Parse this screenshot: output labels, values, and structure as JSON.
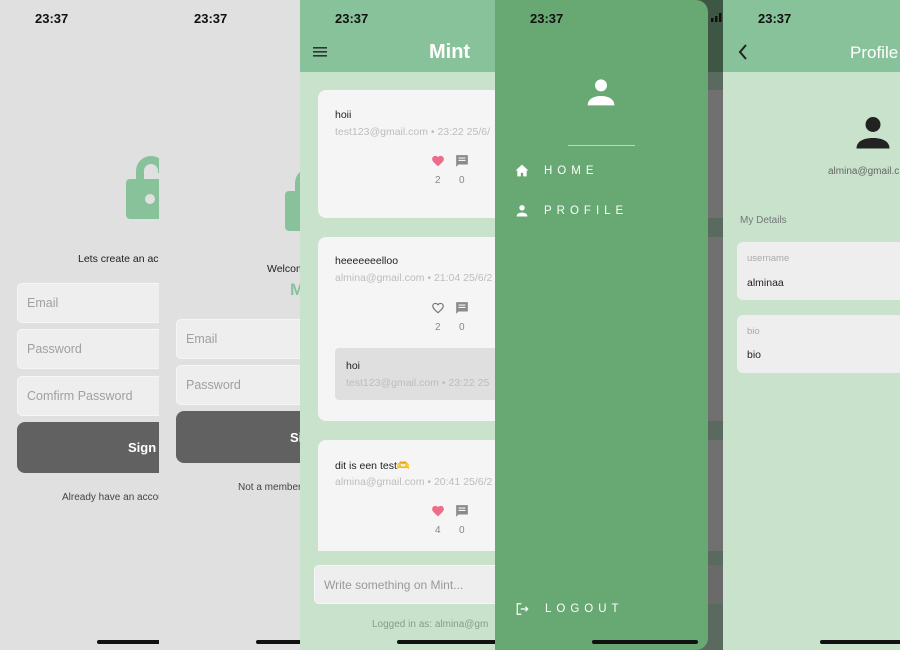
{
  "status_time": "23:37",
  "signup": {
    "subtitle": "Lets create an account",
    "email_placeholder": "Email",
    "password_placeholder": "Password",
    "confirm_placeholder": "Comfirm Password",
    "button": "Sign Up",
    "footer": "Already have an account"
  },
  "login": {
    "welcome": "Welcome",
    "brand": "M",
    "email_placeholder": "Email",
    "password_placeholder": "Password",
    "button": "Sign In",
    "footer": "Not a member"
  },
  "feed": {
    "title": "Mint",
    "posts": [
      {
        "text": "hoii",
        "meta": "test123@gmail.com • 23:22  25/6/",
        "liked": true,
        "likes": "2",
        "comments": "0"
      },
      {
        "text": "heeeeeeelloo",
        "meta": "almina@gmail.com • 21:04  25/6/2",
        "liked": false,
        "likes": "2",
        "comments": "0",
        "reply": {
          "text": "hoi",
          "meta": "test123@gmail.com • 23:22  25"
        }
      },
      {
        "text": "dit is een test🫶",
        "meta": "almina@gmail.com • 20:41  25/6/2",
        "liked": true,
        "likes": "4",
        "comments": "0"
      }
    ],
    "composer_placeholder": "Write something on Mint...",
    "logged_in": "Logged in as: almina@gm"
  },
  "drawer": {
    "items": [
      {
        "label": "HOME",
        "icon": "home-icon"
      },
      {
        "label": "PROFILE",
        "icon": "person-icon"
      }
    ],
    "logout": "LOGOUT"
  },
  "profile": {
    "title": "Profile",
    "email": "almina@gmail.c",
    "section": "My Details",
    "fields": [
      {
        "label": "username",
        "value": "alminaa"
      },
      {
        "label": "bio",
        "value": "bio"
      }
    ]
  },
  "colors": {
    "accent": "#88c29a",
    "drawer": "#67a873",
    "background": "#c8e2cc",
    "like": "#ef6b8a"
  }
}
